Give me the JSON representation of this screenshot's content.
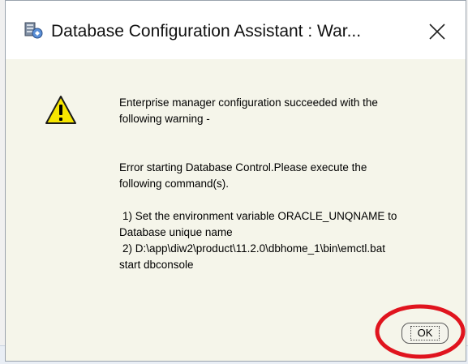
{
  "dialog": {
    "title": "Database Configuration Assistant : War...",
    "close_label": "×"
  },
  "message": {
    "line1": "Enterprise manager configuration succeeded with the",
    "line2": "following warning -",
    "line3": "Error starting Database Control.Please execute the",
    "line4": "following command(s).",
    "line5": "1) Set the environment variable ORACLE_UNQNAME to",
    "line6": "Database unique name",
    "line7": "2) D:\\app\\diw2\\product\\11.2.0\\dbhome_1\\bin\\emctl.bat",
    "line8": "start dbconsole"
  },
  "buttons": {
    "ok_label": "OK"
  },
  "colors": {
    "dialog_background": "#f5f5ea",
    "warning_yellow": "#f7e600",
    "highlight_red": "#e0141e"
  },
  "icons": {
    "app": "database-config-app-icon",
    "warning": "warning-triangle-icon",
    "close": "close-icon"
  }
}
